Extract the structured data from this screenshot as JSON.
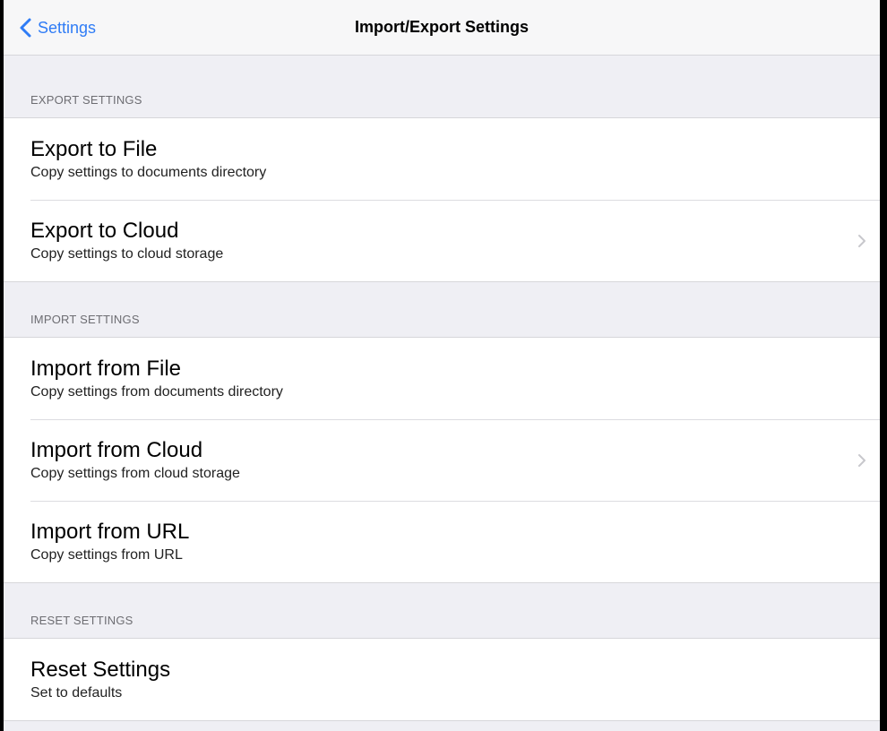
{
  "navbar": {
    "back_label": "Settings",
    "back_icon": "chevron-left-icon",
    "title": "Import/Export Settings"
  },
  "sections": [
    {
      "header": "EXPORT SETTINGS",
      "rows": [
        {
          "title": "Export to File",
          "subtitle": "Copy settings to documents directory",
          "disclosure": false
        },
        {
          "title": "Export to Cloud",
          "subtitle": "Copy settings to cloud storage",
          "disclosure": true
        }
      ]
    },
    {
      "header": "IMPORT SETTINGS",
      "rows": [
        {
          "title": "Import from File",
          "subtitle": "Copy settings from documents directory",
          "disclosure": false
        },
        {
          "title": "Import from Cloud",
          "subtitle": "Copy settings from cloud storage",
          "disclosure": true
        },
        {
          "title": "Import from URL",
          "subtitle": "Copy settings from URL",
          "disclosure": false
        }
      ]
    },
    {
      "header": "RESET SETTINGS",
      "rows": [
        {
          "title": "Reset Settings",
          "subtitle": "Set to defaults",
          "disclosure": false
        }
      ]
    }
  ],
  "colors": {
    "accent": "#2f7cf6",
    "background": "#efeff4",
    "cell": "#ffffff",
    "separator": "#d6d6da",
    "header_text": "#6d6d72",
    "chevron": "#c7c7cc"
  }
}
